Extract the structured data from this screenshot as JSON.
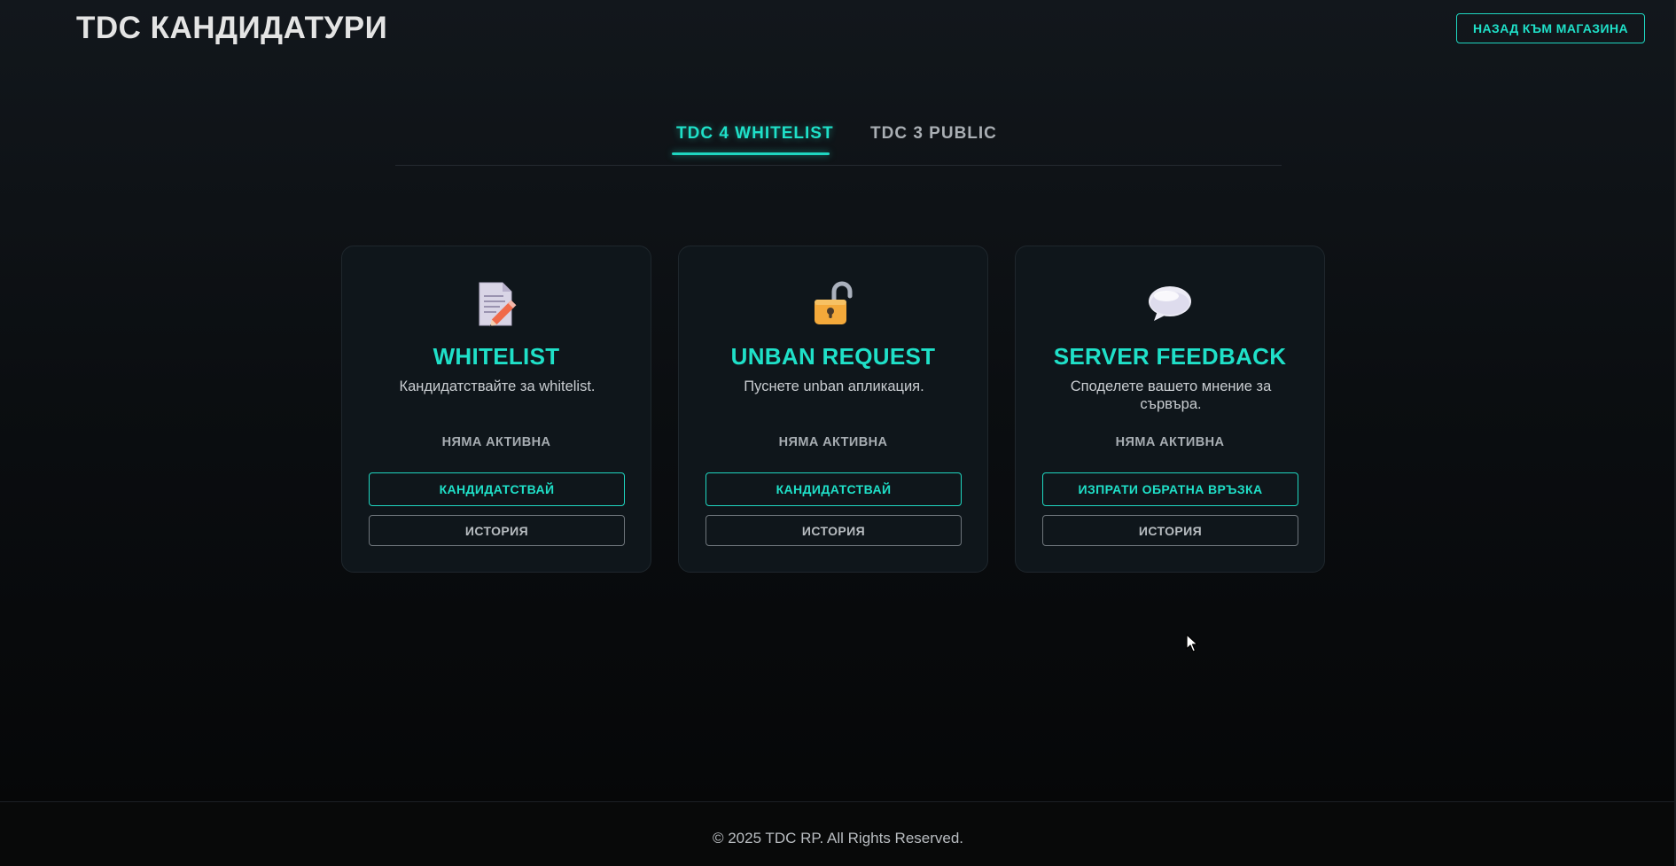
{
  "header": {
    "title": "TDC КАНДИДАТУРИ",
    "back_label": "НАЗАД КЪМ МАГАЗИНА"
  },
  "tabs": [
    {
      "label": "TDC 4 WHITELIST",
      "active": true
    },
    {
      "label": "TDC 3 PUBLIC",
      "active": false
    }
  ],
  "cards": [
    {
      "icon": "document-pencil-icon",
      "title": "WHITELIST",
      "description": "Кандидатствайте за whitelist.",
      "status": "НЯМА АКТИВНА",
      "primary_label": "КАНДИДАТСТВАЙ",
      "secondary_label": "ИСТОРИЯ"
    },
    {
      "icon": "unlocked-padlock-icon",
      "title": "UNBAN REQUEST",
      "description": "Пуснете unban апликация.",
      "status": "НЯМА АКТИВНА",
      "primary_label": "КАНДИДАТСТВАЙ",
      "secondary_label": "ИСТОРИЯ"
    },
    {
      "icon": "speech-bubble-icon",
      "title": "SERVER FEEDBACK",
      "description": "Споделете вашето мнение за сървъра.",
      "status": "НЯМА АКТИВНА",
      "primary_label": "ИЗПРАТИ ОБРАТНА ВРЪЗКА",
      "secondary_label": "ИСТОРИЯ"
    }
  ],
  "footer": {
    "text": "© 2025 TDC RP. All Rights Reserved."
  },
  "colors": {
    "accent": "#1fe0c8",
    "card_bg": "#0f161b",
    "page_bg": "#0b0e11"
  }
}
